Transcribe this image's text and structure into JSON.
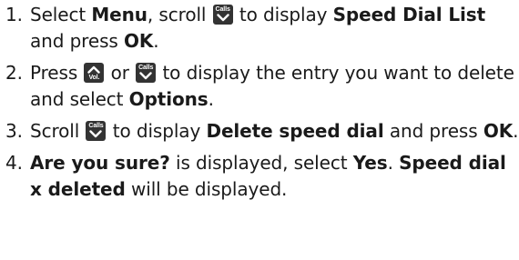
{
  "icons": {
    "calls_down": {
      "name": "calls-down-key-icon",
      "label": "Calls"
    },
    "vol_up": {
      "name": "vol-up-key-icon",
      "label": "Vol."
    }
  },
  "steps": [
    {
      "number": "1.",
      "t1": "Select ",
      "b1": "Menu",
      "t2": ", scroll ",
      "t3": " to display ",
      "b2": "Speed Dial List",
      "t4": " and press ",
      "b3": "OK",
      "t5": "."
    },
    {
      "number": "2.",
      "t1": "Press ",
      "t2": " or ",
      "t3": " to display the entry you want to delete and select ",
      "b1": "Options",
      "t4": "."
    },
    {
      "number": "3.",
      "t1": "Scroll ",
      "t2": " to display ",
      "b1": "Delete speed dial",
      "t3": " and press ",
      "b2": "OK",
      "t4": "."
    },
    {
      "number": "4.",
      "b1": "Are you sure?",
      "t1": " is displayed, select ",
      "b2": "Yes",
      "t2": ". ",
      "b3": "Speed dial x deleted",
      "t3": " will be displayed."
    }
  ]
}
